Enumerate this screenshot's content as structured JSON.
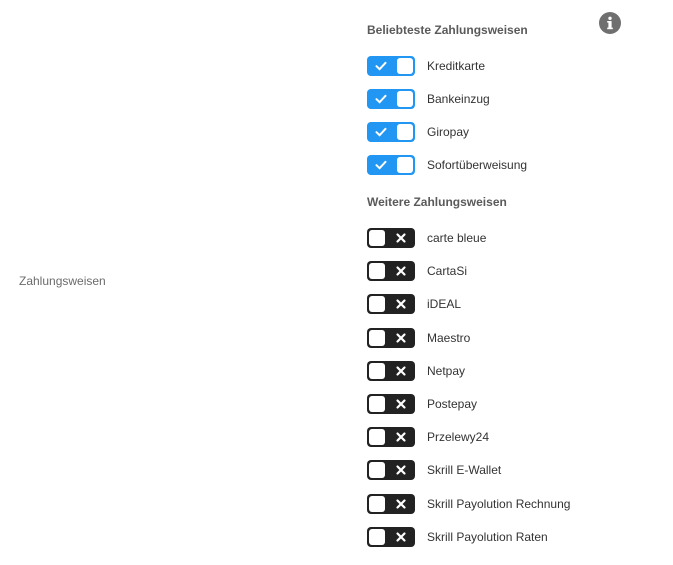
{
  "field_label": "Zahlungsweisen",
  "popular": {
    "heading": "Beliebteste Zahlungsweisen",
    "items": [
      {
        "label": "Kreditkarte",
        "enabled": true
      },
      {
        "label": "Bankeinzug",
        "enabled": true
      },
      {
        "label": "Giropay",
        "enabled": true
      },
      {
        "label": "Sofortüberweisung",
        "enabled": true
      }
    ]
  },
  "more": {
    "heading": "Weitere Zahlungsweisen",
    "items": [
      {
        "label": "carte bleue",
        "enabled": false
      },
      {
        "label": "CartaSi",
        "enabled": false
      },
      {
        "label": "iDEAL",
        "enabled": false
      },
      {
        "label": "Maestro",
        "enabled": false
      },
      {
        "label": "Netpay",
        "enabled": false
      },
      {
        "label": "Postepay",
        "enabled": false
      },
      {
        "label": "Przelewy24",
        "enabled": false
      },
      {
        "label": "Skrill E-Wallet",
        "enabled": false
      },
      {
        "label": "Skrill Payolution Rechnung",
        "enabled": false
      },
      {
        "label": "Skrill Payolution Raten",
        "enabled": false
      }
    ]
  },
  "icons": {
    "info": "info-icon",
    "check": "check-icon",
    "cross": "close-icon"
  },
  "colors": {
    "on": "#2196f3",
    "off": "#222222",
    "info": "#6f6f6f"
  }
}
